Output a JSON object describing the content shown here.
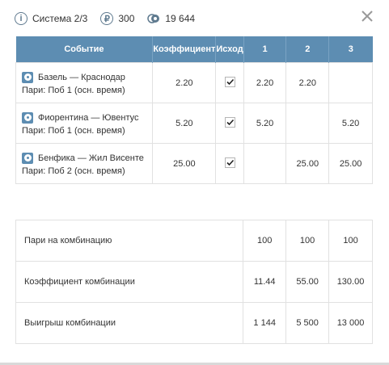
{
  "topbar": {
    "system_label": "Система 2/3",
    "info_icon": "info-icon",
    "ruble_icon_glyph": "₽",
    "ruble_amount": "300",
    "coins_amount": "19 644"
  },
  "table": {
    "headers": [
      "Событие",
      "Коэффициент",
      "Исход",
      "1",
      "2",
      "3"
    ],
    "rows": [
      {
        "match": "Базель — Краснодар",
        "bet": "Пари: Поб 1 (осн. время)",
        "coef": "2.20",
        "checked": true,
        "c1": "2.20",
        "c2": "2.20",
        "c3": ""
      },
      {
        "match": "Фиорентина — Ювентус",
        "bet": "Пари: Поб 1 (осн. время)",
        "coef": "5.20",
        "checked": true,
        "c1": "5.20",
        "c2": "",
        "c3": "5.20"
      },
      {
        "match": "Бенфика — Жил Висенте",
        "bet": "Пари: Поб 2 (осн. время)",
        "coef": "25.00",
        "checked": true,
        "c1": "",
        "c2": "25.00",
        "c3": "25.00"
      }
    ]
  },
  "summary": [
    {
      "label": "Пари на комбинацию",
      "v1": "100",
      "v2": "100",
      "v3": "100"
    },
    {
      "label": "Коэффициент комбинации",
      "v1": "11.44",
      "v2": "55.00",
      "v3": "130.00"
    },
    {
      "label": "Выигрыш комбинации",
      "v1": "1 144",
      "v2": "5 500",
      "v3": "13 000"
    }
  ],
  "colors": {
    "header_bg": "#5d8db2",
    "icon": "#5f7a8f"
  }
}
